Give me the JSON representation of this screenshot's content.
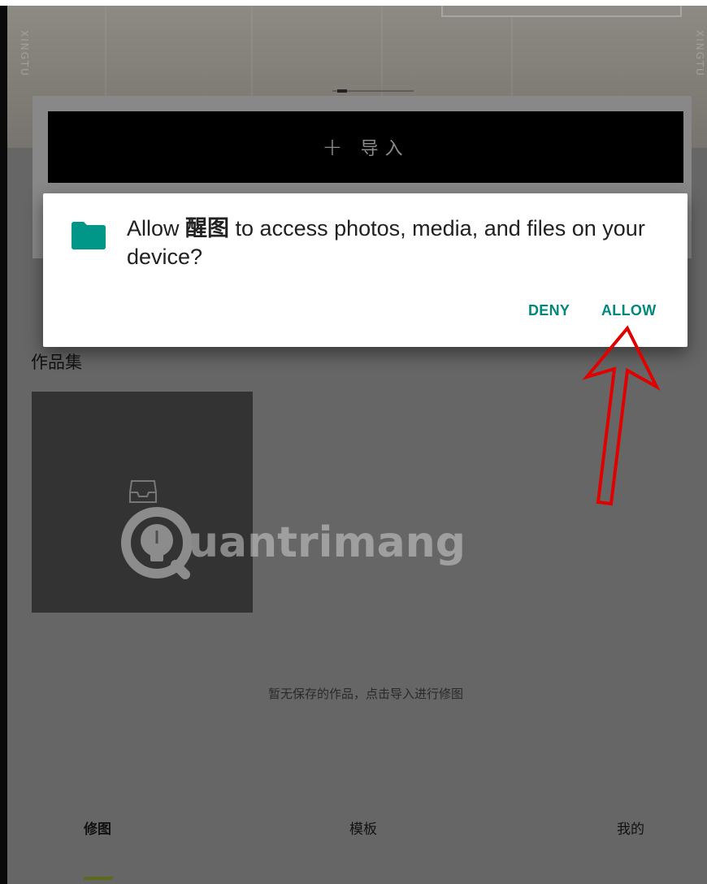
{
  "hero": {
    "brand_vertical": "XINGTU"
  },
  "import_bar": {
    "plus": "+",
    "label": "导入"
  },
  "portfolio": {
    "title": "作品集",
    "empty_message": "暂无保存的作品，点击导入进行修图"
  },
  "watermark": {
    "text": "uantrimang"
  },
  "bottom_nav": {
    "items": [
      {
        "label": "修图",
        "active": true
      },
      {
        "label": "模板",
        "active": false
      },
      {
        "label": "我的",
        "active": false
      }
    ]
  },
  "dialog": {
    "message_prefix": "Allow ",
    "app_name": "醒图",
    "message_suffix": " to access photos, media, and files on your device?",
    "deny_label": "DENY",
    "allow_label": "ALLOW",
    "icon": "folder-icon"
  },
  "colors": {
    "accent": "#00897b",
    "annotation": "#e00000",
    "scrim": "#666666",
    "nav_indicator": "#5b6b17"
  }
}
